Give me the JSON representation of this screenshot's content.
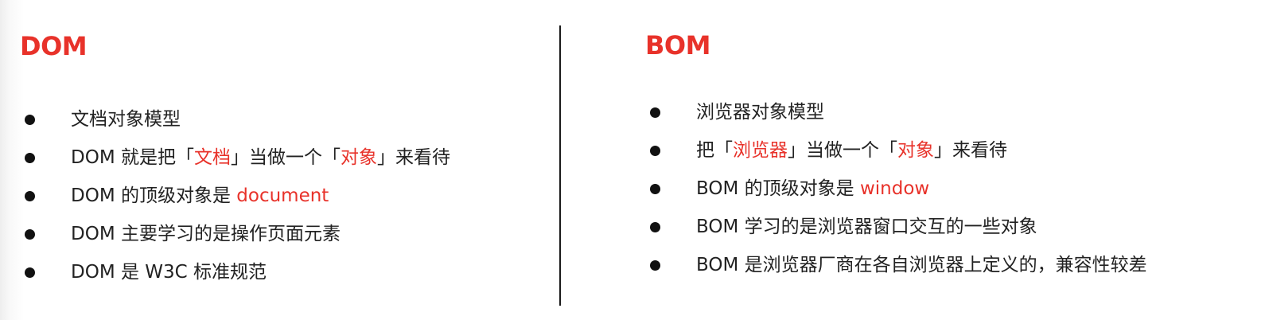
{
  "colors": {
    "title": "#e8322a",
    "highlight": "#e8322a",
    "text": "#222222",
    "bullet": "#111111",
    "divider": "#1a1a1a"
  },
  "dom": {
    "title": "DOM",
    "items": [
      [
        {
          "t": "文档对象模型",
          "hl": false
        }
      ],
      [
        {
          "t": "DOM 就是把「",
          "hl": false
        },
        {
          "t": "文档",
          "hl": true
        },
        {
          "t": "」当做一个「",
          "hl": false
        },
        {
          "t": "对象",
          "hl": true
        },
        {
          "t": "」来看待",
          "hl": false
        }
      ],
      [
        {
          "t": "DOM 的顶级对象是 ",
          "hl": false
        },
        {
          "t": "document",
          "hl": true
        }
      ],
      [
        {
          "t": "DOM 主要学习的是操作页面元素",
          "hl": false
        }
      ],
      [
        {
          "t": "DOM 是 W3C 标准规范",
          "hl": false
        }
      ]
    ]
  },
  "bom": {
    "title": "BOM",
    "items": [
      [
        {
          "t": "浏览器对象模型",
          "hl": false
        }
      ],
      [
        {
          "t": "把「",
          "hl": false
        },
        {
          "t": "浏览器",
          "hl": true
        },
        {
          "t": "」当做一个「",
          "hl": false
        },
        {
          "t": "对象",
          "hl": true
        },
        {
          "t": "」来看待",
          "hl": false
        }
      ],
      [
        {
          "t": "BOM 的顶级对象是 ",
          "hl": false
        },
        {
          "t": "window",
          "hl": true
        }
      ],
      [
        {
          "t": "BOM 学习的是浏览器窗口交互的一些对象",
          "hl": false
        }
      ],
      [
        {
          "t": "BOM 是浏览器厂商在各自浏览器上定义的，兼容性较差",
          "hl": false
        }
      ]
    ]
  }
}
